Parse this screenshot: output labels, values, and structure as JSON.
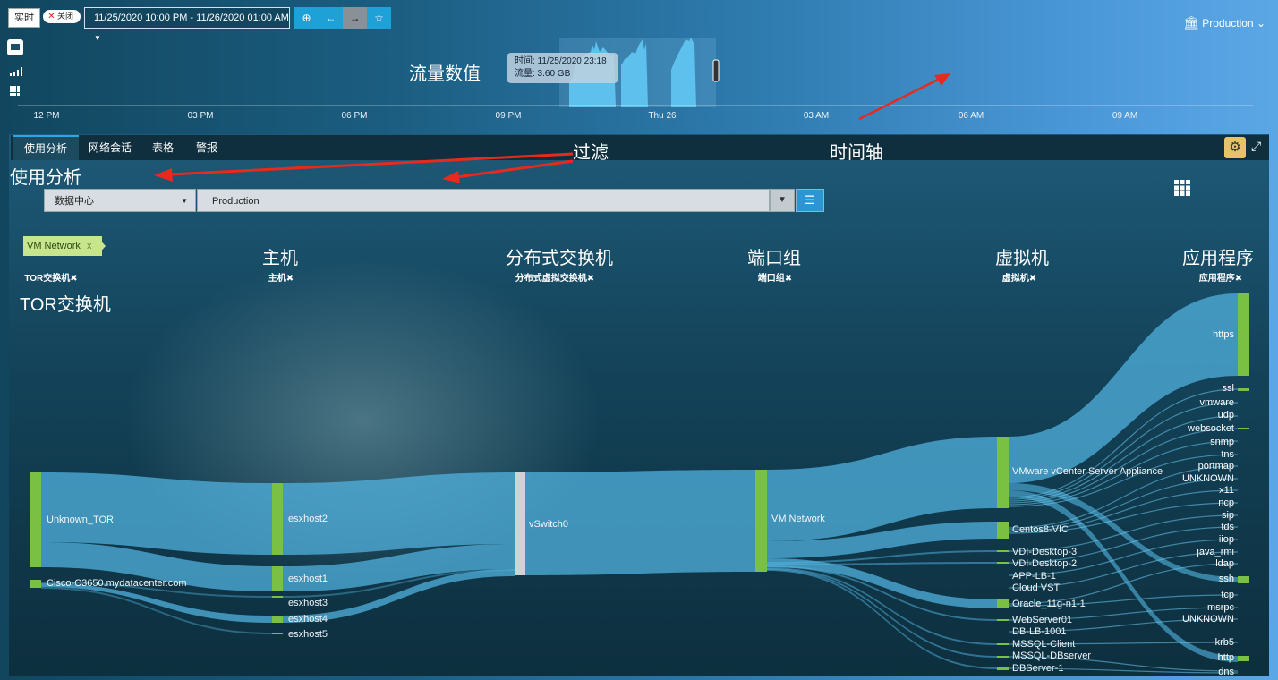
{
  "toolbar": {
    "live_label": "实时",
    "toggle_label": "关闭",
    "date_range": "11/25/2020 10:00 PM - 11/26/2020 01:00 AM",
    "environment": "Production"
  },
  "timeline": {
    "title": "流量数值",
    "tooltip_time": "时间: 11/25/2020 23:18",
    "tooltip_volume": "流量: 3.60 GB",
    "ticks": [
      "12 PM",
      "03 PM",
      "06 PM",
      "09 PM",
      "Thu 26",
      "03 AM",
      "06 AM",
      "09 AM"
    ]
  },
  "tabs": [
    "使用分析",
    "网络会话",
    "表格",
    "警报"
  ],
  "annotations": {
    "filter": "过滤",
    "timeline_axis": "时间轴",
    "usage_analysis": "使用分析",
    "tor_switch": "TOR交换机"
  },
  "filters": {
    "scope": "数据中心",
    "value": "Production",
    "chip": "VM Network"
  },
  "columns": [
    {
      "title": "",
      "sub": "TOR交换机"
    },
    {
      "title": "主机",
      "sub": "主机"
    },
    {
      "title": "分布式交换机",
      "sub": "分布式虚拟交换机"
    },
    {
      "title": "端口组",
      "sub": "端口组"
    },
    {
      "title": "虚拟机",
      "sub": "虚拟机"
    },
    {
      "title": "应用程序",
      "sub": "应用程序"
    }
  ],
  "nodes": {
    "tor": [
      "Unknown_TOR",
      "Cisco-C3650.mydatacenter.com"
    ],
    "hosts": [
      "esxhost2",
      "esxhost1",
      "esxhost3",
      "esxhost4",
      "esxhost5"
    ],
    "switch": "vSwitch0",
    "portgroup": "VM Network",
    "vms": [
      "VMware vCenter Server Appliance",
      "Centos8-VIC",
      "VDI-Desktop-3",
      "VDI-Desktop-2",
      "APP-LB-1",
      "Cloud VST",
      "Oracle_11g-n1-1",
      "WebServer01",
      "DB-LB-1001",
      "MSSQL-Client",
      "MSSQL-DBserver",
      "DBServer-1"
    ],
    "apps": [
      "https",
      "ssl",
      "vmware",
      "udp",
      "websocket",
      "snmp",
      "tns",
      "portmap",
      "UNKNOWN",
      "x11",
      "ncp",
      "sip",
      "tds",
      "iiop",
      "java_rmi",
      "ldap",
      "ssh",
      "tcp",
      "msrpc",
      "UNKNOWN",
      "krb5",
      "http",
      "dns"
    ]
  },
  "colors": {
    "node": "#7ac143",
    "switch": "#cfd3d5",
    "link": "#53b6e3",
    "accent": "#29a9e0",
    "arrow": "#e8291d"
  }
}
